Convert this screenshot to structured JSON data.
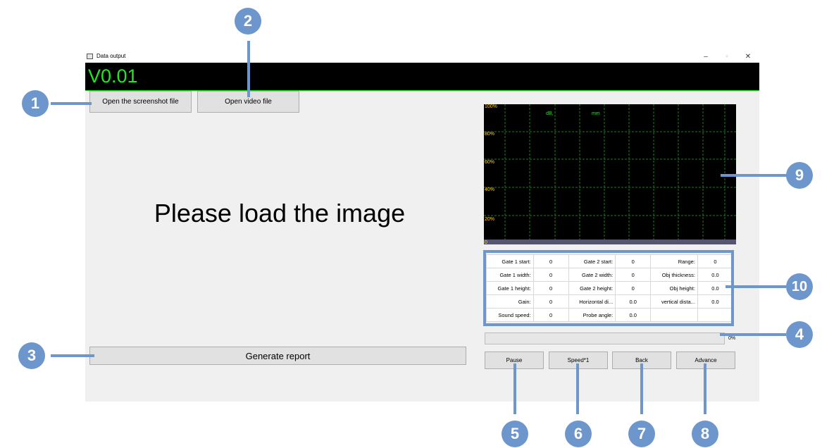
{
  "window": {
    "title": "Data output",
    "controls": {
      "minimize": "–",
      "maximize": "▫",
      "close": "✕"
    }
  },
  "banner": {
    "version": "V0.01",
    "colors": {
      "background": "#000000",
      "text": "#22e622"
    }
  },
  "toolbar": {
    "open_screenshot_label": "Open the screenshot file",
    "open_video_label": "Open video file"
  },
  "image_area": {
    "placeholder": "Please load the image"
  },
  "report": {
    "generate_label": "Generate report"
  },
  "scope": {
    "y_labels": [
      "100%",
      "80%",
      "60%",
      "40%",
      "20%",
      "0"
    ],
    "units": {
      "db": "dB,",
      "mm": "mm"
    },
    "colors": {
      "background": "#000000",
      "grid": "#1e7a1e",
      "labels": "#ffd21e",
      "units": "#2fe02f"
    }
  },
  "params": {
    "rows": [
      [
        {
          "label": "Gate 1 start:",
          "value": "0"
        },
        {
          "label": "Gate 2 start:",
          "value": "0"
        },
        {
          "label": "Range:",
          "value": "0"
        }
      ],
      [
        {
          "label": "Gate 1 width:",
          "value": "0"
        },
        {
          "label": "Gate 2 width:",
          "value": "0"
        },
        {
          "label": "Obj thickness:",
          "value": "0.0"
        }
      ],
      [
        {
          "label": "Gate 1 height:",
          "value": "0"
        },
        {
          "label": "Gate 2 height:",
          "value": "0"
        },
        {
          "label": "Obj height:",
          "value": "0.0"
        }
      ],
      [
        {
          "label": "Gain:",
          "value": "0"
        },
        {
          "label": "Horizontal di...",
          "value": "0.0"
        },
        {
          "label": "vertical dista...",
          "value": "0.0"
        }
      ],
      [
        {
          "label": "Sound speed:",
          "value": "0"
        },
        {
          "label": "Probe angle:",
          "value": "0.0"
        },
        {
          "label": "",
          "value": ""
        }
      ]
    ]
  },
  "progress": {
    "percent_text": "0%",
    "value": 0
  },
  "playback": {
    "pause": "Pause",
    "speed": "Speed*1",
    "back": "Back",
    "advance": "Advance"
  },
  "callouts": [
    "1",
    "2",
    "3",
    "4",
    "5",
    "6",
    "7",
    "8",
    "9",
    "10"
  ],
  "accent_color": "#6c96cc"
}
